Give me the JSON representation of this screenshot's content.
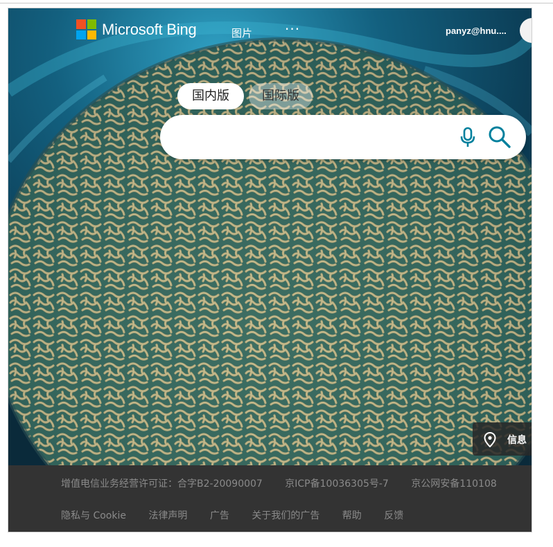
{
  "header": {
    "logo_text": "Microsoft Bing",
    "nav_images": "图片",
    "nav_more": "···",
    "user": "panyz@hnu...."
  },
  "tabs": [
    "国内版",
    "国际版"
  ],
  "search": {
    "value": "",
    "placeholder": ""
  },
  "info_button": {
    "label": "信息"
  },
  "footer": {
    "row1": [
      "增值电信业务经营许可证：合字B2-20090007",
      "京ICP备10036305号-7",
      "京公网安备110108"
    ],
    "row2": [
      "隐私与 Cookie",
      "法律声明",
      "广告",
      "关于我们的广告",
      "帮助",
      "反馈"
    ]
  },
  "colors": {
    "footer_bg": "#333333",
    "footer_text": "#8a8a8a",
    "icon_accent": "#00809d",
    "logo": [
      "#f25022",
      "#7fba00",
      "#00a4ef",
      "#ffb900"
    ]
  },
  "icons": [
    "microsoft-logo-icon",
    "microphone-icon",
    "search-icon",
    "location-pin-icon"
  ]
}
